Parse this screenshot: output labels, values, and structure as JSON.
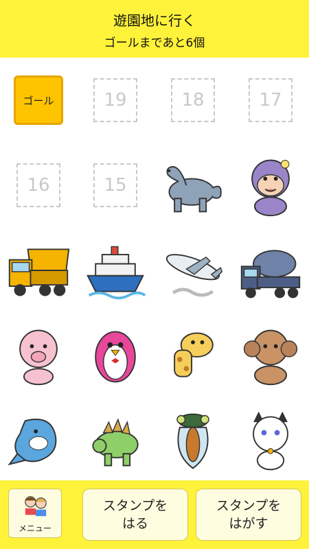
{
  "header": {
    "title": "遊園地に行く",
    "subtitle": "ゴールまであと6個"
  },
  "grid": {
    "goal_label": "ゴール",
    "empty_slots": [
      "19",
      "18",
      "17",
      "16",
      "15"
    ],
    "stamps": [
      "dinosaur",
      "monkey",
      "dump-truck",
      "cruise-ship",
      "airplane",
      "cement-mixer",
      "pig",
      "penguin",
      "giraffe",
      "poodle",
      "dolphin",
      "stegosaurus",
      "cicada",
      "cat"
    ]
  },
  "footer": {
    "menu_label": "メニュー",
    "apply_stamp": [
      "スタンプを",
      "はる"
    ],
    "remove_stamp": [
      "スタンプを",
      "はがす"
    ]
  },
  "colors": {
    "header_bg": "#fff23a",
    "goal_bg": "#ffc400",
    "slot_border": "#c8c8c8"
  }
}
